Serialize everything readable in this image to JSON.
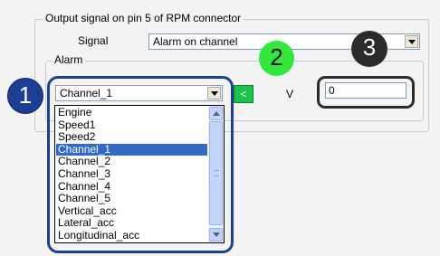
{
  "output_group": {
    "title": "Output signal on pin 5 of RPM connector",
    "signal_label": "Signal",
    "signal_value": "Alarm on channel"
  },
  "alarm_group": {
    "title": "Alarm",
    "channel_value": "Channel_1",
    "arrow_button_label": "<",
    "unit_label": "V",
    "threshold_value": "0"
  },
  "dropdown": {
    "items": [
      "Engine",
      "Speed1",
      "Speed2",
      "Channel_1",
      "Channel_2",
      "Channel_3",
      "Channel_4",
      "Channel_5",
      "Vertical_acc",
      "Lateral_acc",
      "Longitudinal_acc"
    ],
    "selected_index": 3
  },
  "callouts": {
    "badge1": "1",
    "badge2": "2",
    "badge3": "3",
    "colors": {
      "badge1": "#1c3f94",
      "badge2": "#33e83a",
      "badge3": "#2b2b2b",
      "outline": "#1c3f94"
    }
  }
}
